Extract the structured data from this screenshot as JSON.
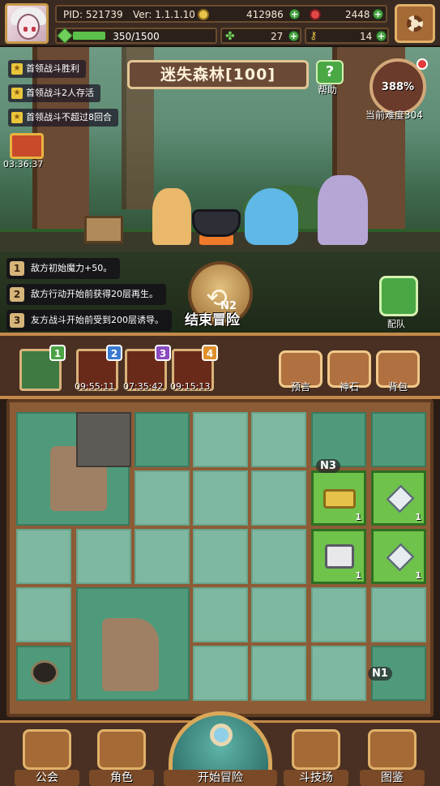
{
  "player": {
    "pid": "PID: 521739",
    "version": "Ver: 1.1.1.10",
    "gold": "412986",
    "gems": "2448",
    "exp": "350/1500",
    "clover": "27",
    "key": "14",
    "exp_progress": 0.233
  },
  "objectives": [
    "首领战斗胜利",
    "首领战斗2人存活",
    "首领战斗不超过8回合"
  ],
  "chest_timer": "03:36:37",
  "stage": {
    "title": "迷失森林[100]",
    "help_label": "帮助",
    "difficulty_pct": "388%",
    "difficulty_label": "当前难度304"
  },
  "modifiers": [
    {
      "num": "1",
      "text": "敌方初始魔力+50。"
    },
    {
      "num": "2",
      "text": "敌方行动开始前获得20层再生。"
    },
    {
      "num": "3",
      "text": "友方战斗开始前受到200层诱导。"
    }
  ],
  "end_button_label": "结束冒险",
  "team_label": "配队",
  "tags": {
    "n1": "N1",
    "n2": "N2",
    "n3": "N3"
  },
  "slots": [
    {
      "badge": "1",
      "timer": "",
      "badge_color": "#4aa344"
    },
    {
      "badge": "2",
      "timer": "09:55:11",
      "badge_color": "#3a7ad0"
    },
    {
      "badge": "3",
      "timer": "07:35:42",
      "badge_color": "#8a4ac0"
    },
    {
      "badge": "4",
      "timer": "09:15:13",
      "badge_color": "#e0902a"
    }
  ],
  "actions": [
    "预言",
    "神石",
    "背包"
  ],
  "grid_items": {
    "gold_qty": "1",
    "gem_qty_1": "1",
    "chest_qty": "1",
    "gem_qty_2": "1"
  },
  "nav": {
    "guild": "公会",
    "character": "角色",
    "start": "开始冒险",
    "arena": "斗技场",
    "codex": "图鉴"
  },
  "colors": {
    "accent": "#c48a4a",
    "green": "#4aa344",
    "frame": "#8c5c36"
  }
}
